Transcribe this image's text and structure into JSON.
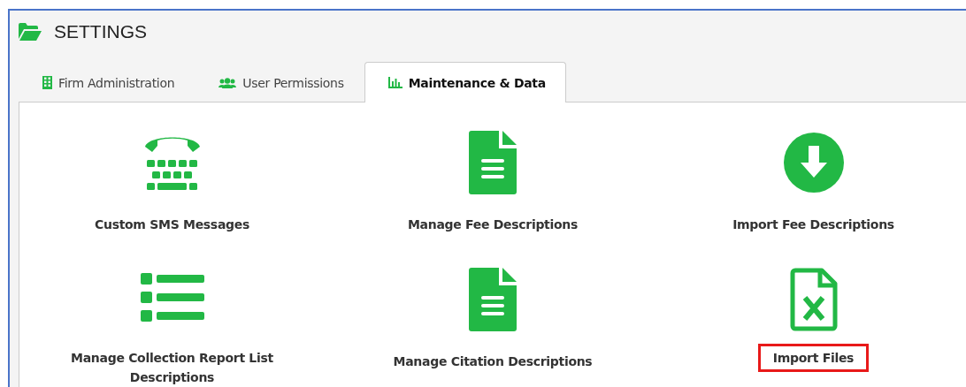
{
  "window": {
    "title": "SETTINGS"
  },
  "tabs": [
    {
      "label": "Firm Administration",
      "kind": "building",
      "selected": false
    },
    {
      "label": "User Permissions",
      "kind": "users",
      "selected": false
    },
    {
      "label": "Maintenance & Data",
      "kind": "chart",
      "selected": true
    }
  ],
  "items": [
    {
      "label": "Custom SMS Messages",
      "kind": "phone",
      "highlighted": false
    },
    {
      "label": "Manage Fee Descriptions",
      "kind": "document",
      "highlighted": false
    },
    {
      "label": "Import Fee Descriptions",
      "kind": "download",
      "highlighted": false
    },
    {
      "label": "Manage Collection Report List Descriptions",
      "kind": "list",
      "highlighted": false
    },
    {
      "label": "Manage Citation Descriptions",
      "kind": "document",
      "highlighted": false
    },
    {
      "label": "Import Files",
      "kind": "excel",
      "highlighted": true
    }
  ]
}
